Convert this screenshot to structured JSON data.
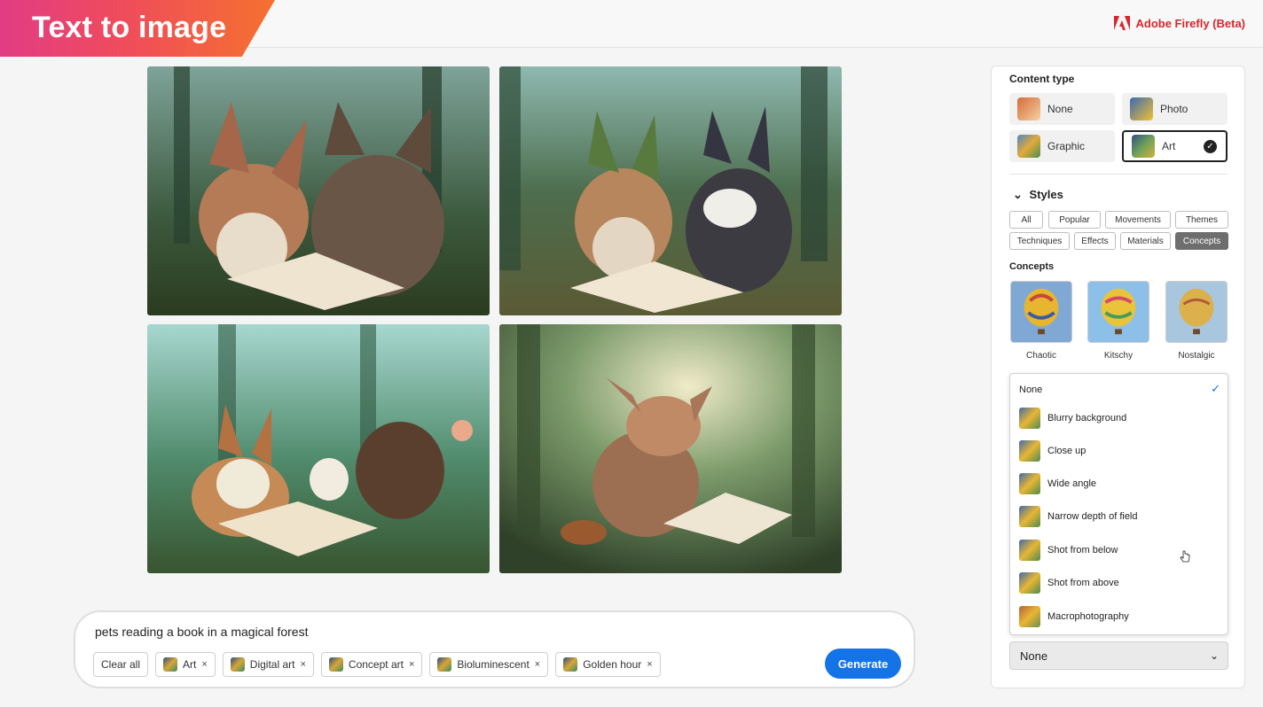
{
  "banner": {
    "title": "Text to image"
  },
  "brand": {
    "label": "Adobe Firefly (Beta)"
  },
  "gallery": {
    "images": [
      {
        "name": "pets-reading-image-1"
      },
      {
        "name": "pets-reading-image-2"
      },
      {
        "name": "pets-reading-image-3"
      },
      {
        "name": "pets-reading-image-4"
      }
    ]
  },
  "prompt": {
    "text": "pets reading a book in a magical forest",
    "clear_label": "Clear all",
    "chips": [
      "Art",
      "Digital art",
      "Concept art",
      "Bioluminescent",
      "Golden hour"
    ],
    "chip_remove": "×",
    "generate_label": "Generate"
  },
  "panel": {
    "content_type": {
      "heading": "Content type",
      "options": [
        "None",
        "Photo",
        "Graphic",
        "Art"
      ],
      "selected": "Art",
      "check": "✓"
    },
    "styles": {
      "heading": "Styles",
      "chevron": "⌄",
      "tabs": [
        "All",
        "Popular",
        "Movements",
        "Themes",
        "Techniques",
        "Effects",
        "Materials",
        "Concepts"
      ],
      "active": "Concepts"
    },
    "concepts": {
      "heading": "Concepts",
      "items": [
        "Chaotic",
        "Kitschy",
        "Nostalgic"
      ]
    },
    "dropdown": {
      "none_label": "None",
      "check": "✓",
      "items": [
        "Blurry background",
        "Close up",
        "Wide angle",
        "Narrow depth of field",
        "Shot from below",
        "Shot from above",
        "Macrophotography"
      ]
    },
    "select": {
      "value": "None",
      "chevron": "⌄"
    }
  },
  "colors": {
    "accent": "#1473e6",
    "banner_start": "#e23c85",
    "banner_end": "#f5712f",
    "brand": "#d7262d"
  }
}
